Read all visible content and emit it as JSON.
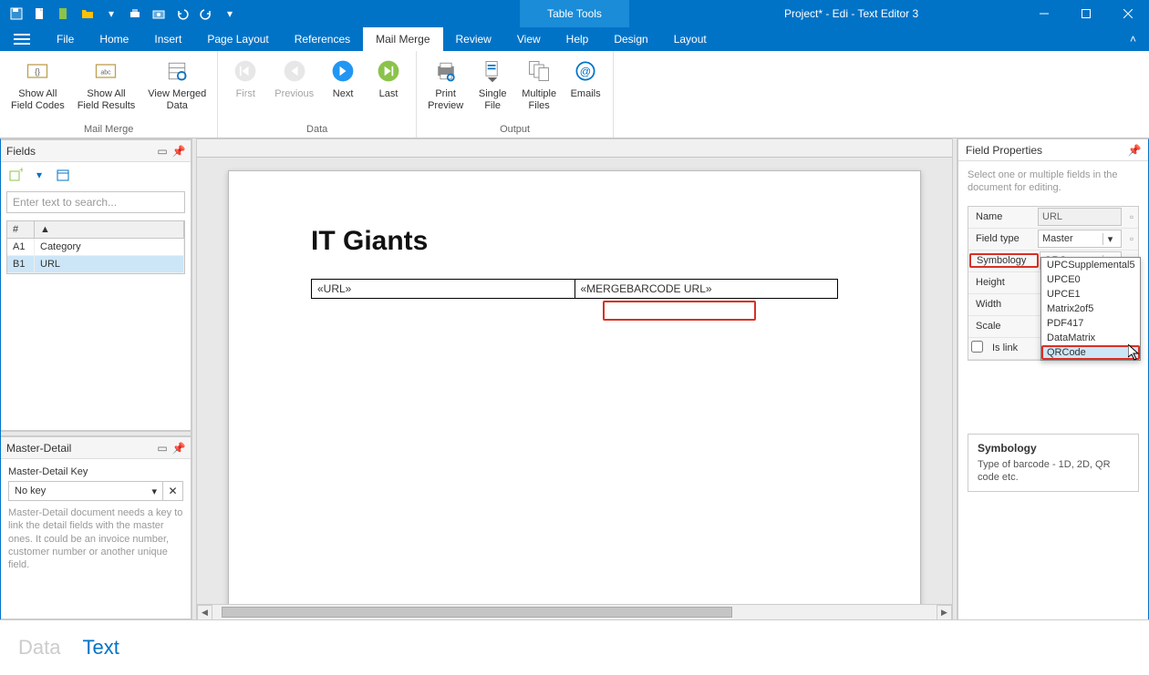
{
  "titlebar": {
    "contextual": "Table Tools",
    "title": "Project* - Edi - Text Editor 3"
  },
  "menu": {
    "tabs": [
      "File",
      "Home",
      "Insert",
      "Page Layout",
      "References",
      "Mail Merge",
      "Review",
      "View",
      "Help",
      "Design",
      "Layout"
    ],
    "active": "Mail Merge"
  },
  "ribbon": {
    "groups": [
      {
        "label": "Mail Merge",
        "items": [
          {
            "id": "show-field-codes",
            "text": "Show All\nField Codes"
          },
          {
            "id": "show-field-results",
            "text": "Show All\nField Results"
          },
          {
            "id": "view-merged-data",
            "text": "View Merged\nData"
          }
        ]
      },
      {
        "label": "Data",
        "items": [
          {
            "id": "first",
            "text": "First",
            "disabled": true
          },
          {
            "id": "previous",
            "text": "Previous",
            "disabled": true
          },
          {
            "id": "next",
            "text": "Next"
          },
          {
            "id": "last",
            "text": "Last"
          }
        ]
      },
      {
        "label": "Output",
        "items": [
          {
            "id": "print-preview",
            "text": "Print\nPreview"
          },
          {
            "id": "single-file",
            "text": "Single\nFile"
          },
          {
            "id": "multiple-files",
            "text": "Multiple\nFiles"
          },
          {
            "id": "emails",
            "text": "Emails"
          }
        ]
      }
    ]
  },
  "fields_panel": {
    "title": "Fields",
    "search_placeholder": "Enter text to search...",
    "header_col": "#",
    "rows": [
      {
        "id": "A1",
        "name": "Category"
      },
      {
        "id": "B1",
        "name": "URL",
        "selected": true
      }
    ]
  },
  "master_detail": {
    "title": "Master-Detail",
    "key_label": "Master-Detail Key",
    "key_value": "No key",
    "help": "Master-Detail document needs a key to link the detail fields with the master ones. It could be an invoice number, customer number or another unique field."
  },
  "document": {
    "heading": "IT Giants",
    "cell_left": "«URL»",
    "cell_right": "«MERGEBARCODE URL»"
  },
  "field_properties": {
    "title": "Field Properties",
    "help": "Select one or multiple fields in the document for editing.",
    "rows": {
      "name_label": "Name",
      "name_value": "URL",
      "fieldtype_label": "Field type",
      "fieldtype_value": "Master",
      "symbology_label": "Symbology",
      "symbology_value": "QRCo...",
      "height_label": "Height",
      "width_label": "Width",
      "scale_label": "Scale",
      "islink_label": "Is link"
    },
    "dropdown": [
      "UPCSupplemental5",
      "UPCE0",
      "UPCE1",
      "Matrix2of5",
      "PDF417",
      "DataMatrix",
      "QRCode"
    ],
    "dropdown_selected": "QRCode",
    "desc_title": "Symbology",
    "desc_text": "Type of barcode - 1D, 2D, QR code etc."
  },
  "bottom_tabs": {
    "data": "Data",
    "text": "Text",
    "active": "Text"
  }
}
